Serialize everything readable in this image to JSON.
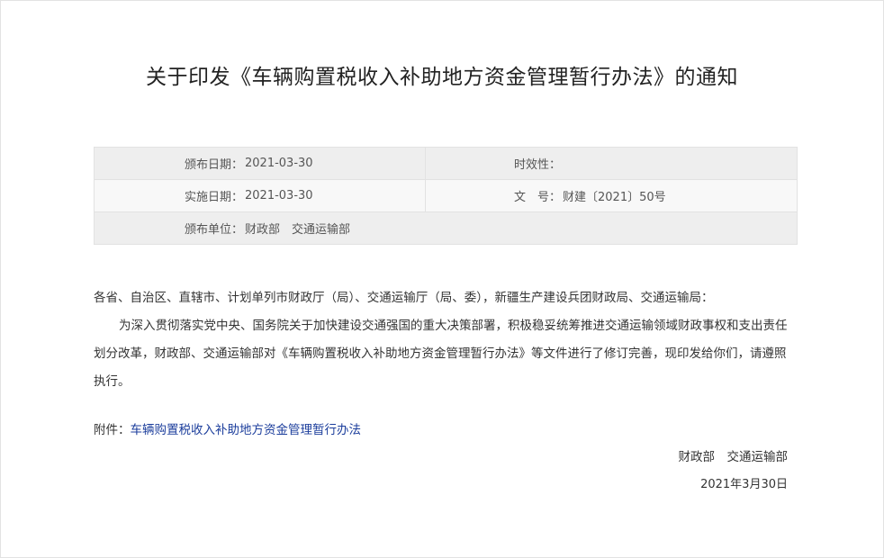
{
  "document": {
    "title": "关于印发《车辆购置税收入补助地方资金管理暂行办法》的通知"
  },
  "meta": {
    "publish_date_label": "颁布日期：",
    "publish_date_value": "2021-03-30",
    "validity_label": "时效性：",
    "validity_value": "",
    "effective_date_label": "实施日期：",
    "effective_date_value": "2021-03-30",
    "doc_number_label": "文　号：",
    "doc_number_value": "财建〔2021〕50号",
    "issuer_label": "颁布单位：",
    "issuer_value": "财政部　交通运输部"
  },
  "body": {
    "salutation": "各省、自治区、直辖市、计划单列市财政厅（局）、交通运输厅（局、委），新疆生产建设兵团财政局、交通运输局：",
    "paragraph": "为深入贯彻落实党中央、国务院关于加快建设交通强国的重大决策部署，积极稳妥统筹推进交通运输领域财政事权和支出责任划分改革，财政部、交通运输部对《车辆购置税收入补助地方资金管理暂行办法》等文件进行了修订完善，现印发给你们，请遵照执行。"
  },
  "attachment": {
    "label": "附件：",
    "link_text": "车辆购置税收入补助地方资金管理暂行办法",
    "link_color": "#1c3e9c"
  },
  "footer": {
    "signatories": "财政部　交通运输部",
    "date": "2021年3月30日"
  }
}
